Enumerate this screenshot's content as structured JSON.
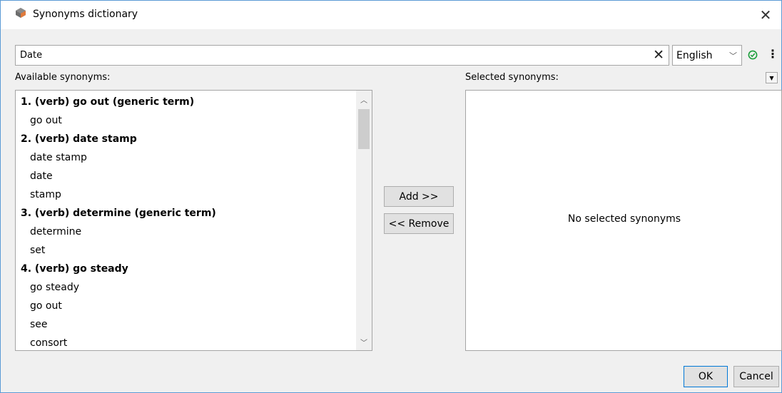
{
  "window": {
    "title": "Synonyms dictionary",
    "close_glyph": "✕"
  },
  "search": {
    "value": "Date",
    "clear_glyph": "✕"
  },
  "language": {
    "selected": "English"
  },
  "available": {
    "label": "Available synonyms:",
    "items": [
      {
        "type": "group",
        "text": "1. (verb) go out (generic term)"
      },
      {
        "type": "syn",
        "text": "go out"
      },
      {
        "type": "group",
        "text": "2. (verb) date stamp"
      },
      {
        "type": "syn",
        "text": "date stamp"
      },
      {
        "type": "syn",
        "text": "date"
      },
      {
        "type": "syn",
        "text": "stamp"
      },
      {
        "type": "group",
        "text": "3. (verb) determine (generic term)"
      },
      {
        "type": "syn",
        "text": "determine"
      },
      {
        "type": "syn",
        "text": "set"
      },
      {
        "type": "group",
        "text": "4. (verb) go steady"
      },
      {
        "type": "syn",
        "text": "go steady"
      },
      {
        "type": "syn",
        "text": "go out"
      },
      {
        "type": "syn",
        "text": "see"
      },
      {
        "type": "syn",
        "text": "consort"
      }
    ]
  },
  "actions": {
    "add_label": "Add >>",
    "remove_label": "<< Remove"
  },
  "selected": {
    "label": "Selected synonyms:",
    "empty_text": "No selected synonyms"
  },
  "footer": {
    "ok_label": "OK",
    "cancel_label": "Cancel"
  },
  "colors": {
    "accent": "#0078d7",
    "check_green": "#1a9e3a",
    "app_icon_orange": "#e07a3c",
    "app_icon_gray": "#6d6d6d"
  }
}
